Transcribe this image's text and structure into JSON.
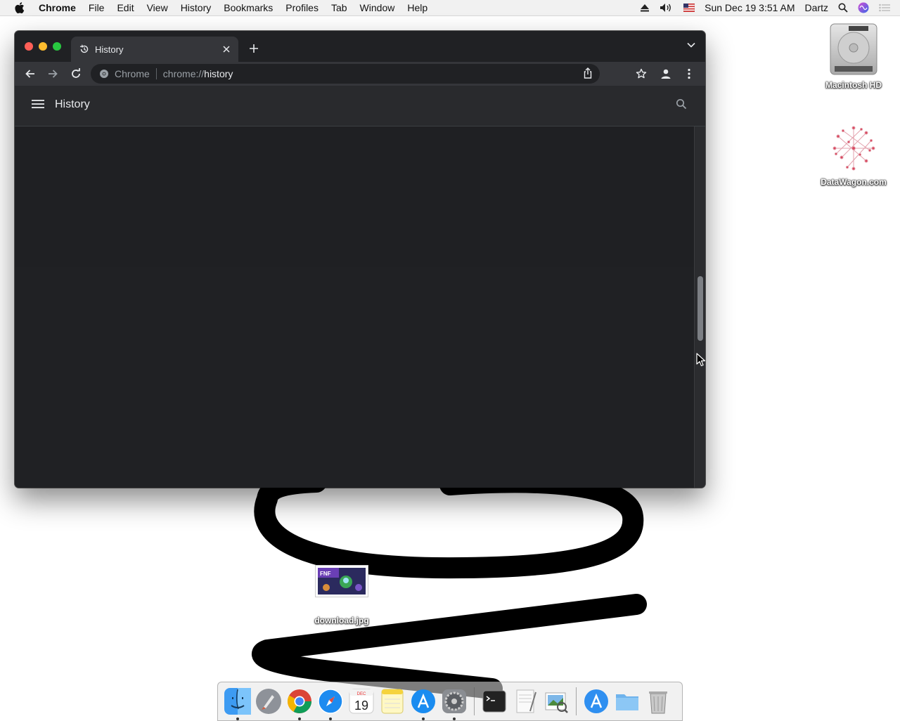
{
  "menubar": {
    "apple_icon": "apple-logo-icon",
    "items": [
      "Chrome",
      "File",
      "Edit",
      "View",
      "History",
      "Bookmarks",
      "Profiles",
      "Tab",
      "Window",
      "Help"
    ],
    "clock": "Sun Dec 19  3:51 AM",
    "user": "Dartz",
    "status_icons": [
      "eject-icon",
      "volume-icon",
      "us-flag-icon",
      "spotlight-icon",
      "siri-icon",
      "notification-center-icon"
    ]
  },
  "desktop": {
    "icons": [
      {
        "label": "Macintosh HD",
        "icon": "hard-drive-icon"
      },
      {
        "label": "DataWagon.com",
        "icon": "datawagon-file-icon"
      },
      {
        "label": "download.jpg",
        "icon": "image-thumbnail-icon"
      }
    ]
  },
  "browser": {
    "tab": {
      "title": "History",
      "icon": "history-icon"
    },
    "omnibox": {
      "site_name": "Chrome",
      "url_scheme": "chrome://",
      "url_path": "history"
    },
    "page": {
      "title": "History"
    },
    "scrollbar_position": 0.45
  },
  "dock": {
    "items": [
      "finder-icon",
      "launchpad-icon",
      "chrome-icon",
      "safari-icon",
      "calendar-icon",
      "notes-icon",
      "app-store-icon",
      "system-preferences-icon",
      "terminal-icon",
      "textedit-icon",
      "preview-icon",
      "app-store-folder-icon",
      "folder-icon",
      "trash-icon"
    ],
    "calendar": {
      "month": "DEC",
      "day": "19"
    }
  },
  "colors": {
    "window_bg": "#202124",
    "toolbar_bg": "#35363a",
    "accent_text": "#e8eaed"
  }
}
